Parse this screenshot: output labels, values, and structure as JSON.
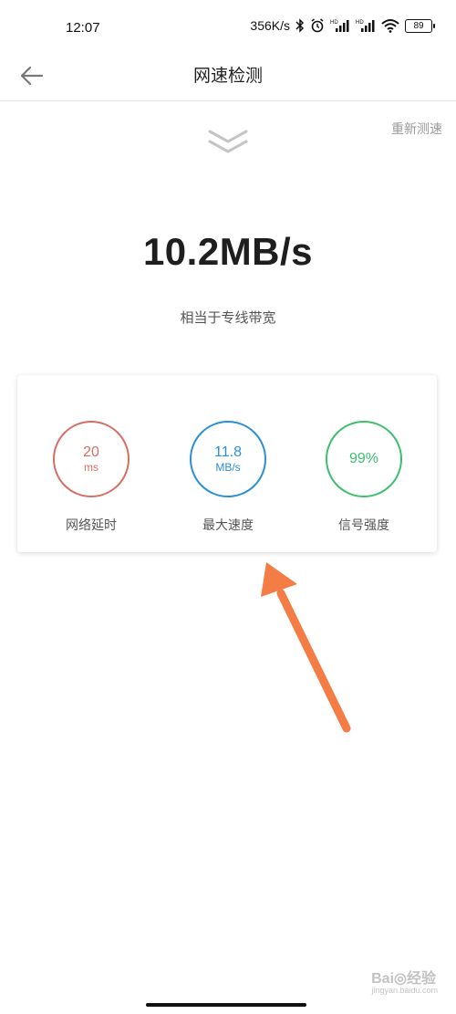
{
  "status_bar": {
    "time": "12:07",
    "network_speed": "356K/s",
    "battery": "89",
    "icons": [
      "bluetooth-icon",
      "alarm-icon",
      "signal-hd-icon",
      "signal-hd-icon",
      "wifi-icon",
      "battery-icon"
    ]
  },
  "header": {
    "title": "网速检测",
    "back_icon": "back-arrow-icon"
  },
  "retest_label": "重新测速",
  "speed": {
    "value": "10.2MB/s",
    "caption": "相当于专线带宽"
  },
  "stats": [
    {
      "value": "20",
      "unit": "ms",
      "label": "网络延时",
      "color": "#d76e66"
    },
    {
      "value": "11.8",
      "unit": "MB/s",
      "label": "最大速度",
      "color": "#2b8fd6"
    },
    {
      "value": "99%",
      "unit": "",
      "label": "信号强度",
      "color": "#3cbf6e"
    }
  ],
  "annotation_color": "#f47c45",
  "watermark": {
    "text": "Bai◎经验",
    "sub": "jingyan.baidu.com"
  }
}
